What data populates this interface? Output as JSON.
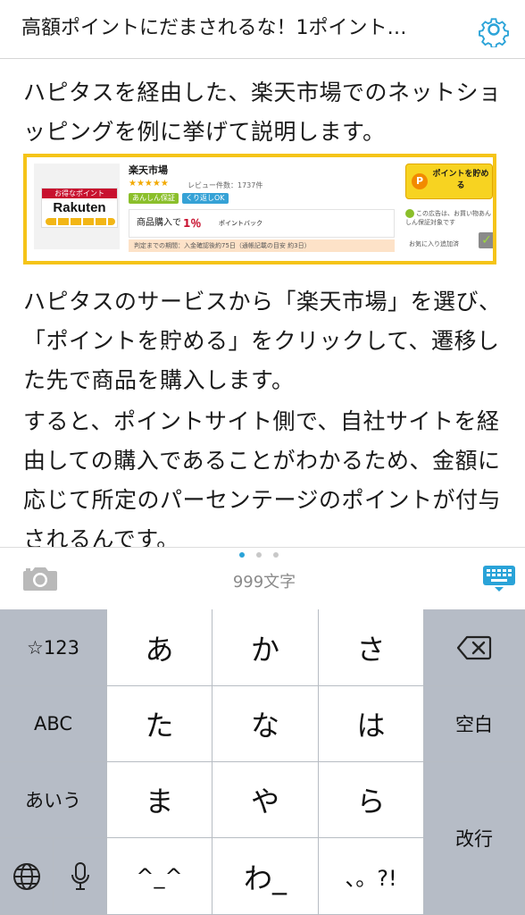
{
  "header": {
    "title": "高額ポイントにだまされるな！1ポイント…",
    "settings_icon": "gear-icon",
    "accent_color": "#2aa3d8"
  },
  "article": {
    "paragraphs": [
      "ハピタスを経由した、楽天市場でのネットショッピングを例に挙げて説明します。",
      "ハピタスのサービスから「楽天市場」を選び、「ポイントを貯める」をクリックして、遷移した先で商品を購入します。",
      "すると、ポイントサイト側で、自社サイトを経由しての購入であることがわかるため、金額に応じて所定のパーセンテージのポイントが付与されるんです。"
    ],
    "embed": {
      "logo_caption": "お得なポイント",
      "logo_text": "Rakuten",
      "shop_name": "楽天市場",
      "stars": "★★★★★",
      "rating": 5,
      "review_count": "レビュー件数：1737件",
      "tags": [
        "あんしん保証",
        "くり返しOK"
      ],
      "rate_label": "商品購入で",
      "rate_value": "1％",
      "rate_unit": "ポイントバック",
      "note": "判定までの期間：入金確認後約75日（通帳記載の目安 約3日）",
      "button_icon_letter": "P",
      "button_label": "ポイントを貯める",
      "ad_note": "この広告は、お買い物あんしん保証対象です",
      "fav_label": "お気に入り追加済",
      "fav_check": "✓",
      "border_color": "#f5c418"
    }
  },
  "toolbar": {
    "page_dots": 3,
    "active_dot": 0,
    "camera_icon": "camera-icon",
    "char_count": "999文字",
    "keyboard_icon": "keyboard-icon"
  },
  "keyboard": {
    "left_keys": [
      "☆123",
      "ABC",
      "あいう"
    ],
    "grid_keys": [
      [
        "あ",
        "か",
        "さ"
      ],
      [
        "た",
        "な",
        "は"
      ],
      [
        "ま",
        "や",
        "ら"
      ],
      [
        "^_^",
        "わ_",
        "、。?!"
      ]
    ],
    "right_keys": {
      "backspace_icon": "backspace-icon",
      "space": "空白",
      "enter": "改行"
    },
    "globe_icon": "globe-icon",
    "mic_icon": "mic-icon"
  }
}
